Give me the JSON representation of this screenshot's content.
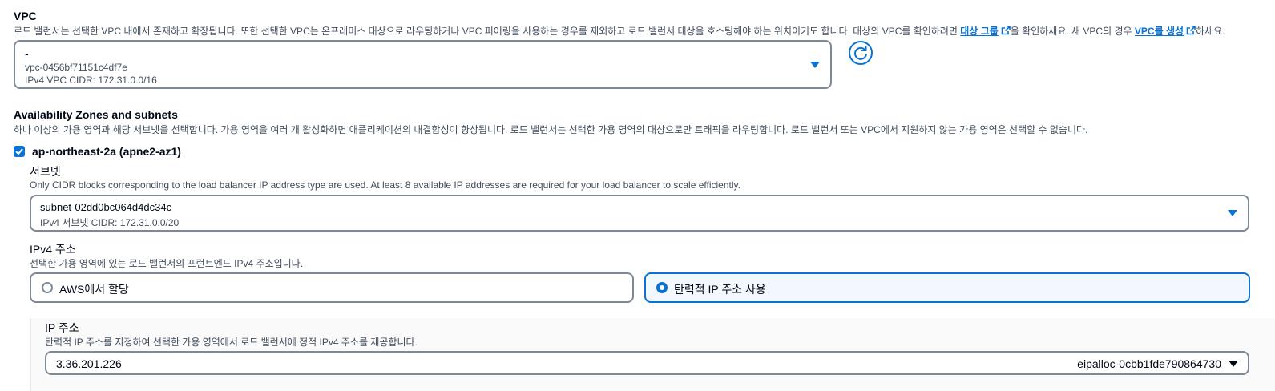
{
  "vpc": {
    "heading": "VPC",
    "desc_part1": "로드 밸런서는 선택한 VPC 내에서 존재하고 확장됩니다. 또한 선택한 VPC는 온프레미스 대상으로 라우팅하거나 VPC 피어링을 사용하는 경우를 제외하고 로드 밸런서 대상을 호스팅해야 하는 위치이기도 합니다. 대상의 VPC를 확인하려면",
    "link1": "대상 그룹",
    "desc_part2": "을 확인하세요. 새 VPC의 경우",
    "link2": "VPC를 생성",
    "desc_part3": "하세요.",
    "select": {
      "name": "-",
      "id": "vpc-0456bf71151c4df7e",
      "cidr": "IPv4 VPC CIDR: 172.31.0.0/16"
    },
    "icons": {
      "refresh": "refresh-icon",
      "external": "external-link-icon",
      "caret": "caret-down-icon"
    }
  },
  "az": {
    "heading": "Availability Zones and subnets",
    "desc": "하나 이상의 가용 영역과 해당 서브넷을 선택합니다. 가용 영역을 여러 개 활성화하면 애플리케이션의 내결함성이 향상됩니다. 로드 밸런서는 선택한 가용 영역의 대상으로만 트래픽을 라우팅합니다. 로드 밸런서 또는 VPC에서 지원하지 않는 가용 영역은 선택할 수 없습니다.",
    "zone": {
      "label": "ap-northeast-2a (apne2-az1)",
      "checked": true,
      "subnet_label": "서브넷",
      "subnet_desc": "Only CIDR blocks corresponding to the load balancer IP address type are used. At least 8 available IP addresses are required for your load balancer to scale efficiently.",
      "subnet_select": {
        "id": "subnet-02dd0bc064d4dc34c",
        "cidr": "IPv4 서브넷 CIDR: 172.31.0.0/20"
      },
      "ipv4_label": "IPv4 주소",
      "ipv4_desc": "선택한 가용 영역에 있는 로드 밸런서의 프런트엔드 IPv4 주소입니다.",
      "options": [
        {
          "label": "AWS에서 할당",
          "selected": false
        },
        {
          "label": "탄력적 IP 주소 사용",
          "selected": true
        }
      ],
      "ip_label": "IP 주소",
      "ip_desc": "탄력적 IP 주소를 지정하여 선택한 가용 영역에서 로드 밸런서에 정적 IPv4 주소를 제공합니다.",
      "ip_select": {
        "address": "3.36.201.226",
        "alloc_id": "eipalloc-0cbb1fde790864730"
      }
    }
  },
  "colors": {
    "accent": "#0972d3",
    "text": "#000716",
    "muted": "#414d5c",
    "border": "#7d8998"
  }
}
